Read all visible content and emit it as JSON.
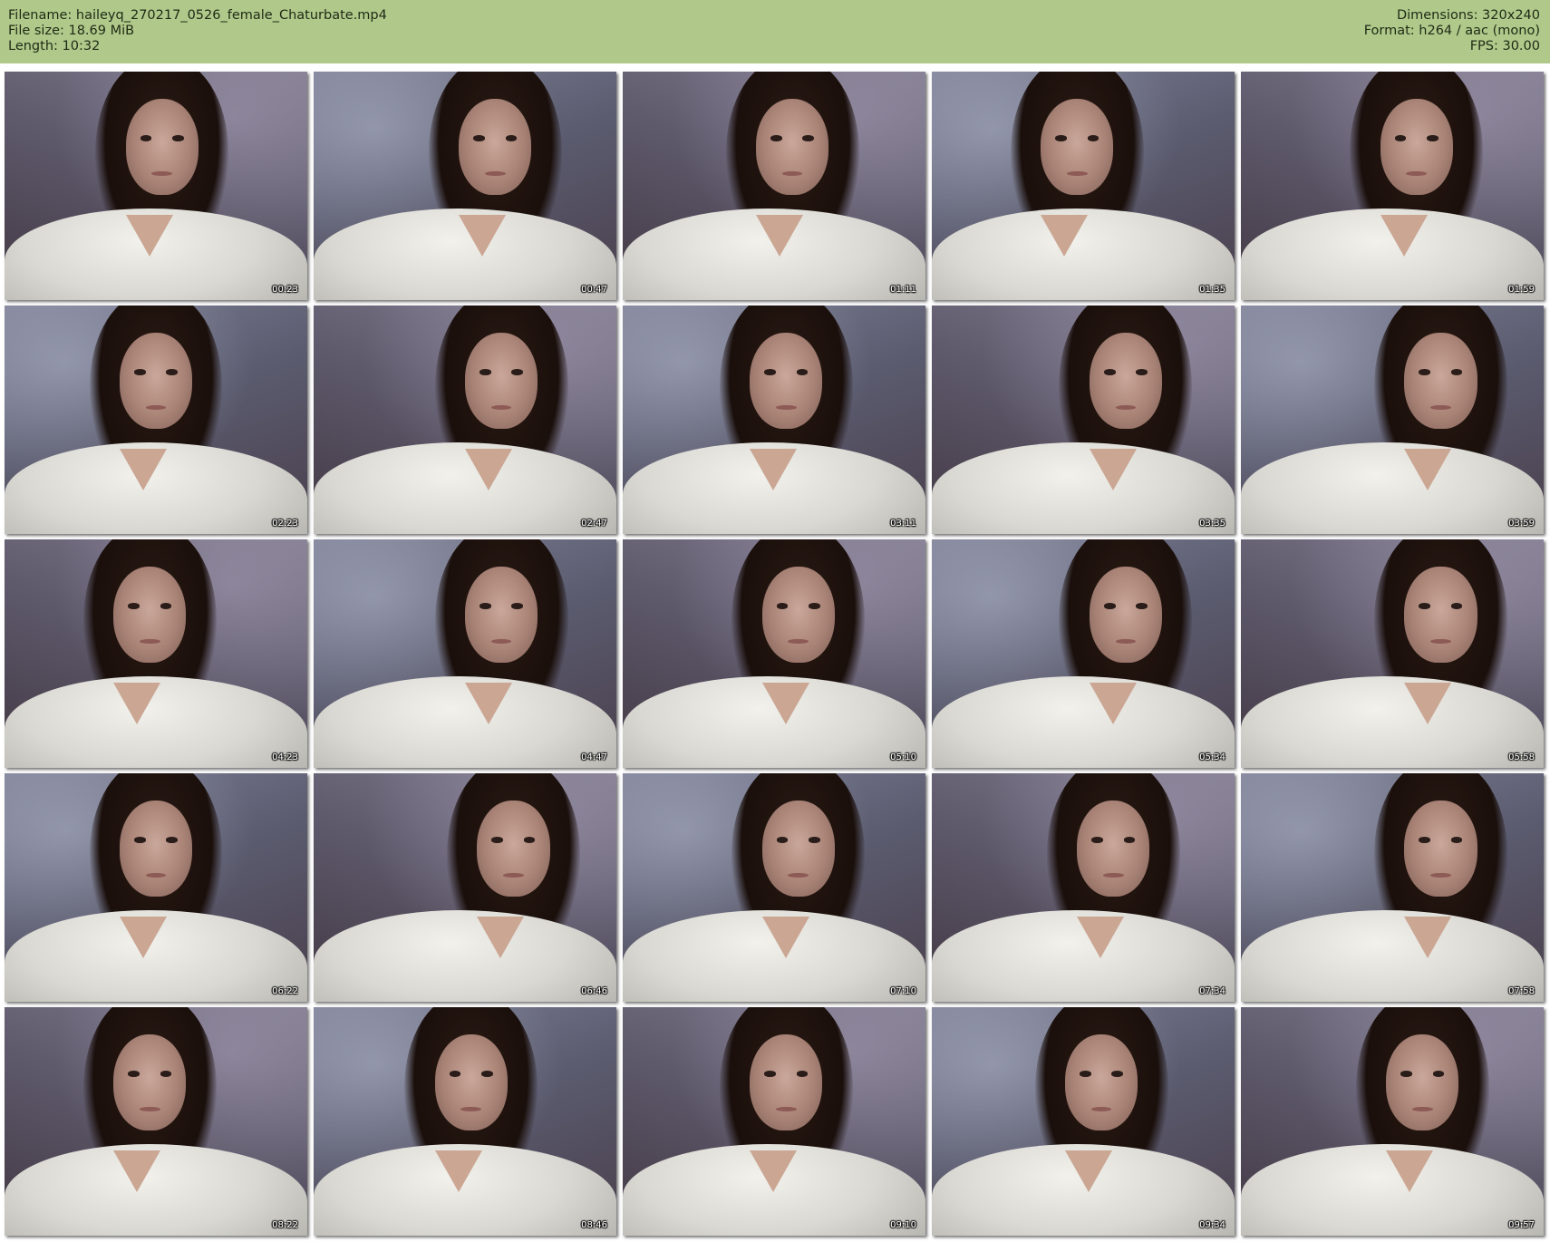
{
  "header": {
    "left": [
      "Filename: haileyq_270217_0526_female_Chaturbate.mp4",
      "File size: 18.69 MiB",
      "Length: 10:32"
    ],
    "right": [
      "Dimensions: 320x240",
      "Format: h264 / aac (mono)",
      "FPS: 30.00"
    ],
    "background": "#b0c98a"
  },
  "thumbnails": [
    {
      "time": "00:23"
    },
    {
      "time": "00:47"
    },
    {
      "time": "01:11"
    },
    {
      "time": "01:35"
    },
    {
      "time": "01:59"
    },
    {
      "time": "02:23"
    },
    {
      "time": "02:47"
    },
    {
      "time": "03:11"
    },
    {
      "time": "03:35"
    },
    {
      "time": "03:59"
    },
    {
      "time": "04:23"
    },
    {
      "time": "04:47"
    },
    {
      "time": "05:10"
    },
    {
      "time": "05:34"
    },
    {
      "time": "05:58"
    },
    {
      "time": "06:22"
    },
    {
      "time": "06:46"
    },
    {
      "time": "07:10"
    },
    {
      "time": "07:34"
    },
    {
      "time": "07:58"
    },
    {
      "time": "08:22"
    },
    {
      "time": "08:46"
    },
    {
      "time": "09:10"
    },
    {
      "time": "09:34"
    },
    {
      "time": "09:57"
    }
  ]
}
